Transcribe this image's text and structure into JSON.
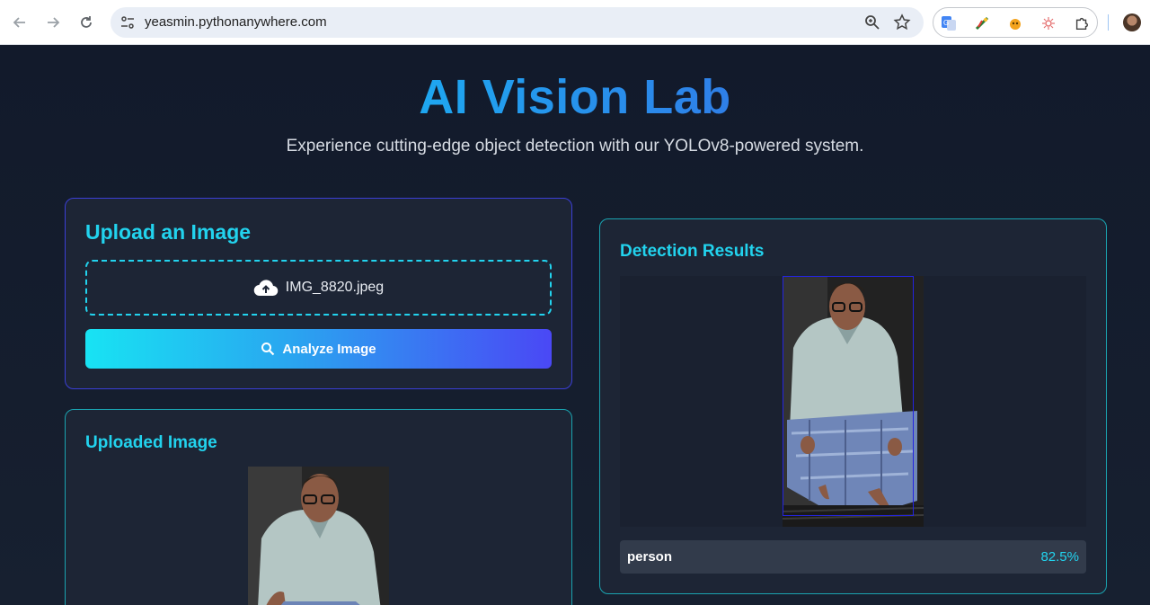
{
  "browser": {
    "url": "yeasmin.pythonanywhere.com",
    "icons": [
      "back-icon",
      "forward-icon",
      "reload-icon",
      "site-info-icon",
      "zoom-icon",
      "bookmark-star-icon",
      "translate-extension-icon",
      "extension-icon",
      "extension-icon",
      "extension-icon",
      "extensions-puzzle-icon",
      "profile-avatar"
    ]
  },
  "header": {
    "title": "AI Vision Lab",
    "subtitle": "Experience cutting-edge object detection with our YOLOv8-powered system."
  },
  "upload": {
    "heading": "Upload an Image",
    "file_name": "IMG_8820.jpeg",
    "analyze_label": "Analyze Image"
  },
  "uploaded": {
    "heading": "Uploaded Image"
  },
  "results": {
    "heading": "Detection Results",
    "detections": [
      {
        "label": "person",
        "score": "82.5%"
      }
    ]
  },
  "colors": {
    "accent_cyan": "#22d3ee",
    "title_blue": "#1e90f0",
    "button_start": "#18e3f3",
    "button_end": "#4a48f5",
    "bbox": "#2424e0",
    "page_bg": "#141b2b"
  }
}
